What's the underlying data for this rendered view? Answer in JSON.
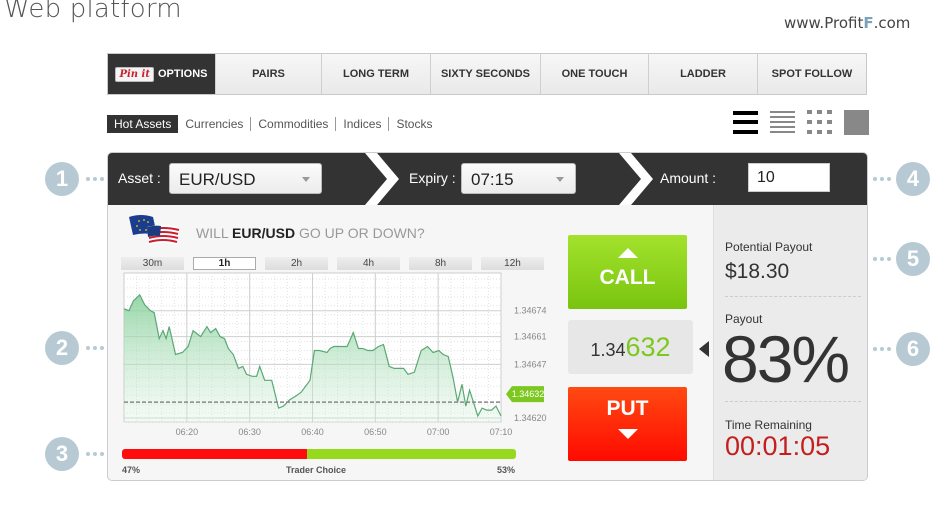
{
  "header": {
    "title": "Web platform",
    "site_url_prefix": "www.Profit",
    "site_url_logo": "F",
    "site_url_suffix": ".com"
  },
  "topnav": {
    "pinit_label": "Pin it",
    "tabs": [
      {
        "label": "OPTIONS",
        "active": true
      },
      {
        "label": "PAIRS"
      },
      {
        "label": "LONG TERM"
      },
      {
        "label": "SIXTY SECONDS"
      },
      {
        "label": "ONE TOUCH"
      },
      {
        "label": "LADDER"
      },
      {
        "label": "SPOT FOLLOW"
      }
    ]
  },
  "subnav": {
    "items": [
      {
        "label": "Hot Assets",
        "active": true
      },
      {
        "label": "Currencies"
      },
      {
        "label": "Commodities"
      },
      {
        "label": "Indices"
      },
      {
        "label": "Stocks"
      }
    ]
  },
  "view_icons": [
    "list-large-icon",
    "list-compact-icon",
    "grid-icon",
    "single-tile-icon"
  ],
  "trade_bar": {
    "asset_label": "Asset :",
    "asset_value": "EUR/USD",
    "expiry_label": "Expiry :",
    "expiry_value": "07:15",
    "amount_label": "Amount :",
    "amount_value": "10"
  },
  "question": {
    "prefix": "WILL ",
    "asset": "EUR/USD",
    "suffix": " GO UP OR DOWN?"
  },
  "timeframes": [
    {
      "label": "30m"
    },
    {
      "label": "1h",
      "active": true
    },
    {
      "label": "2h"
    },
    {
      "label": "4h"
    },
    {
      "label": "8h"
    },
    {
      "label": "12h"
    }
  ],
  "chart_data": {
    "type": "area",
    "title": "",
    "xlabel": "",
    "ylabel": "",
    "x_ticks": [
      "06:20",
      "06:30",
      "06:40",
      "06:50",
      "07:00",
      "07:10"
    ],
    "y_ticks": [
      "1.34674",
      "1.34661",
      "1.34647",
      "1.34620"
    ],
    "y_tick_values": [
      1.34674,
      1.34661,
      1.34647,
      1.3462
    ],
    "ylim": [
      1.34618,
      1.34693
    ],
    "x_range_minutes": [
      0,
      60
    ],
    "current_price_label": "1.34632",
    "current_price": 1.34632,
    "grid": true,
    "series": [
      {
        "name": "EUR/USD",
        "x_minutes": [
          0,
          0.8,
          1.5,
          2.5,
          3.3,
          4.2,
          4.8,
          5.6,
          6.2,
          6.7,
          7.2,
          7.7,
          8.2,
          9.3,
          10.2,
          11,
          11.8,
          12.2,
          13.2,
          13.8,
          14.6,
          15.3,
          16,
          16.6,
          17.4,
          18.2,
          18.9,
          19.5,
          20.4,
          21.1,
          21.6,
          22.4,
          23.5,
          24.6,
          25.4,
          26.3,
          27.3,
          28.2,
          29.6,
          30.3,
          31.1,
          32.3,
          32.8,
          33.4,
          34.5,
          35.5,
          36.5,
          37.3,
          38,
          38.8,
          39.6,
          40.5,
          41.3,
          42.2,
          43,
          43.7,
          44.5,
          45.2,
          46.2,
          47.3,
          48.3,
          49.2,
          50.1,
          50.8,
          51.6,
          52.4,
          53.1,
          53.8,
          54.4,
          55,
          55.6,
          56.3,
          57,
          57.7,
          58.5,
          59.2,
          60
        ],
        "values": [
          1.34675,
          1.34674,
          1.34679,
          1.34682,
          1.34677,
          1.34674,
          1.34673,
          1.3466,
          1.34664,
          1.3466,
          1.34666,
          1.34659,
          1.34652,
          1.34653,
          1.34656,
          1.34664,
          1.34662,
          1.34661,
          1.34666,
          1.34663,
          1.34665,
          1.34661,
          1.3466,
          1.34655,
          1.34652,
          1.34645,
          1.34646,
          1.34642,
          1.34641,
          1.34641,
          1.34646,
          1.34639,
          1.34639,
          1.34625,
          1.34626,
          1.34629,
          1.34631,
          1.34633,
          1.34639,
          1.34654,
          1.34654,
          1.34653,
          1.34655,
          1.34656,
          1.34656,
          1.34656,
          1.34663,
          1.34655,
          1.34655,
          1.34654,
          1.34654,
          1.34656,
          1.34657,
          1.34646,
          1.34645,
          1.34645,
          1.34645,
          1.34642,
          1.34643,
          1.34654,
          1.34656,
          1.34653,
          1.34654,
          1.34652,
          1.34651,
          1.3464,
          1.34628,
          1.34637,
          1.34626,
          1.34634,
          1.34628,
          1.34621,
          1.34625,
          1.34624,
          1.34624,
          1.34626,
          1.34621,
          1.34628
        ]
      }
    ]
  },
  "trade_buttons": {
    "call_label": "CALL",
    "put_label": "PUT",
    "price_prefix": "1.34",
    "price_suffix": "632"
  },
  "trader_choice": {
    "label": "Trader Choice",
    "put_percent": 47,
    "call_percent": 53,
    "put_label": "47%",
    "call_label": "53%",
    "put_color": "#ff0d0d",
    "call_color": "#96d91d"
  },
  "payout": {
    "potential_label": "Potential Payout",
    "potential_value": "$18.30",
    "payout_label": "Payout",
    "payout_value": "83%",
    "time_label": "Time Remaining",
    "time_value": "00:01:05",
    "time_progress": 0.82
  },
  "markers": [
    "1",
    "2",
    "3",
    "4",
    "5",
    "6"
  ],
  "colors": {
    "accent_green": "#7cc820",
    "put_red": "#ff1a00",
    "dark_bar": "#333333",
    "timer_red": "#c41e1e",
    "marker": "#b7cad4"
  }
}
